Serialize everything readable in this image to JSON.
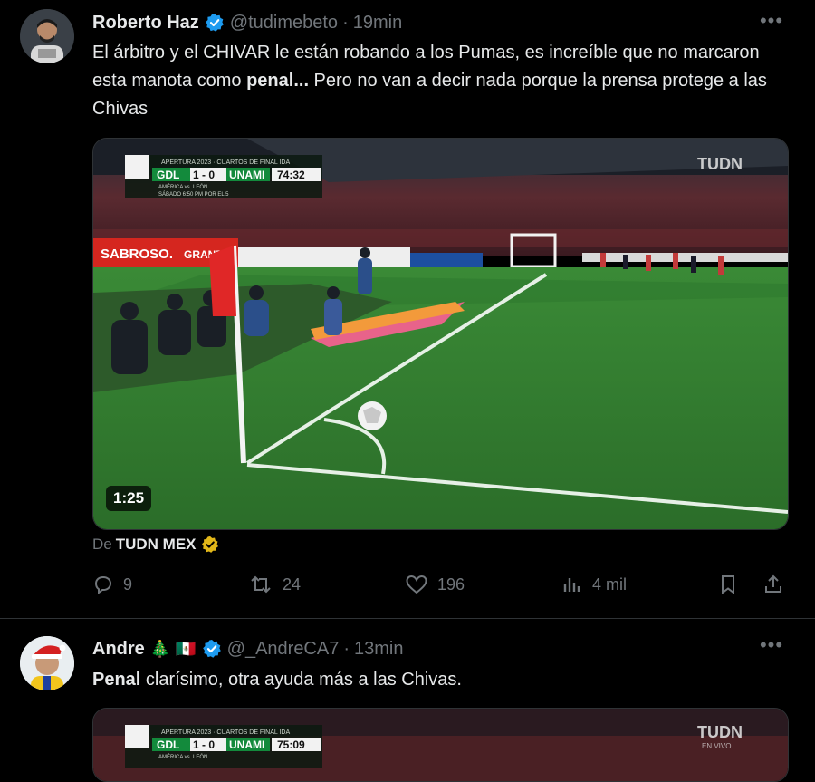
{
  "tweet1": {
    "name": "Roberto Haz",
    "handle": "@tudimebeto",
    "time": "19min",
    "text_a": "El árbitro y el CHIVAR le están robando a los Pumas, es increíble que no marcaron esta manota como ",
    "text_bold": "penal...",
    "text_b": " Pero no van a decir nada porque la prensa protege a las Chivas",
    "video_duration": "1:25",
    "scoreboard": {
      "competition": "APERTURA 2023 · CUARTOS DE FINAL IDA",
      "home": "GDL",
      "score": "1 - 0",
      "away": "UNAMI",
      "clock": "74:32",
      "promo_line1": "AMÉRICA vs. LEÓN",
      "promo_line2": "SÁBADO 6:50 PM POR EL 5"
    },
    "broadcaster": "TUDN",
    "ad_text_1": "SABROSO.",
    "ad_text_2": "GRANDE",
    "source_prefix": "De",
    "source_name": "TUDN MEX",
    "replies": "9",
    "retweets": "24",
    "likes": "196",
    "views": "4 mil"
  },
  "tweet2": {
    "name": "Andre",
    "emoji_tree": "🎄",
    "emoji_flag": "🇲🇽",
    "handle": "@_AndreCA7",
    "time": "13min",
    "text_bold": "Penal",
    "text_rest": " clarísimo, otra ayuda más a las Chivas.",
    "scoreboard": {
      "competition": "APERTURA 2023 · CUARTOS DE FINAL IDA",
      "home": "GDL",
      "score": "1 - 0",
      "away": "UNAMI",
      "clock": "75:09",
      "promo_line1": "AMÉRICA vs. LEÓN"
    },
    "broadcaster": "TUDN",
    "broadcaster_sub": "EN VIVO"
  },
  "colors": {
    "background": "#000000",
    "text": "#e7e9ea",
    "muted": "#71767b",
    "verified": "#1d9bf0",
    "gold_badge": "#e2b719",
    "pitch": "#2f7a2e"
  }
}
